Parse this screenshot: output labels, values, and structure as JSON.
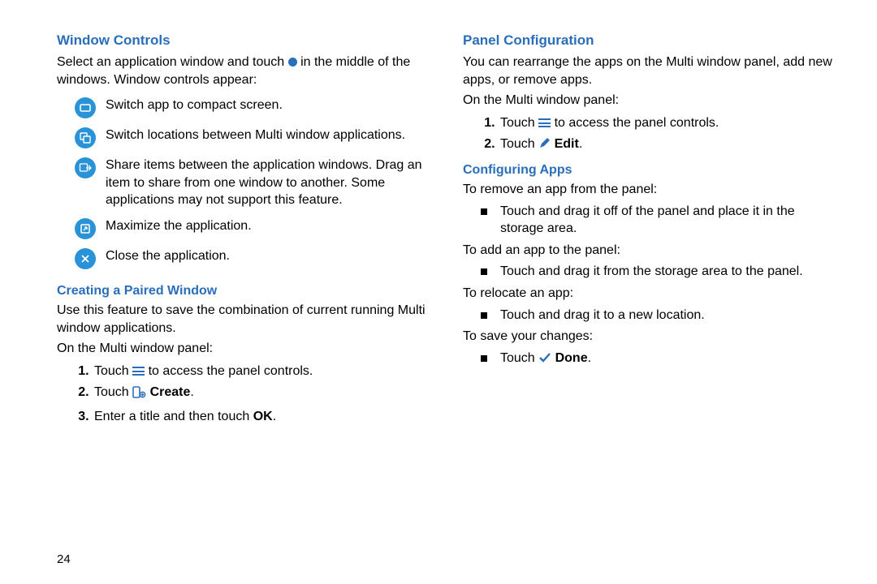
{
  "page_number": "24",
  "left": {
    "h1": "Window Controls",
    "intro_a": "Select an application window and touch ",
    "intro_b": " in the middle of the windows. Window controls appear:",
    "items": [
      "Switch app to compact screen.",
      "Switch locations between Multi window applications.",
      "Share items between the application windows. Drag an item to share from one window to another. Some applications may not support this feature.",
      "Maximize the application.",
      "Close the application."
    ],
    "h2": "Creating a Paired Window",
    "paired_intro": "Use this feature to save the combination of current running Multi window applications.",
    "paired_on": "On the Multi window panel:",
    "paired_steps": {
      "s1a": "Touch ",
      "s1b": " to access the panel controls.",
      "s2a": "Touch ",
      "s2b": "Create",
      "s2c": ".",
      "s3a": "Enter a title and then touch ",
      "s3b": "OK",
      "s3c": "."
    }
  },
  "right": {
    "h1": "Panel Configuration",
    "config_intro": "You can rearrange the apps on the Multi window panel, add new apps, or remove apps.",
    "config_on": "On the Multi window panel:",
    "config_steps": {
      "s1a": "Touch ",
      "s1b": " to access the panel controls.",
      "s2a": "Touch ",
      "s2b": "Edit",
      "s2c": "."
    },
    "h2": "Configuring Apps",
    "remove_lead": "To remove an app from the panel:",
    "remove_item": "Touch and drag it off of the panel and place it in the storage area.",
    "add_lead": "To add an app to the panel:",
    "add_item": "Touch and drag it from the storage area to the panel.",
    "relocate_lead": "To relocate an app:",
    "relocate_item": "Touch and drag it to a new location.",
    "save_lead": "To save your changes:",
    "save_item_a": "Touch ",
    "save_item_b": "Done",
    "save_item_c": "."
  }
}
